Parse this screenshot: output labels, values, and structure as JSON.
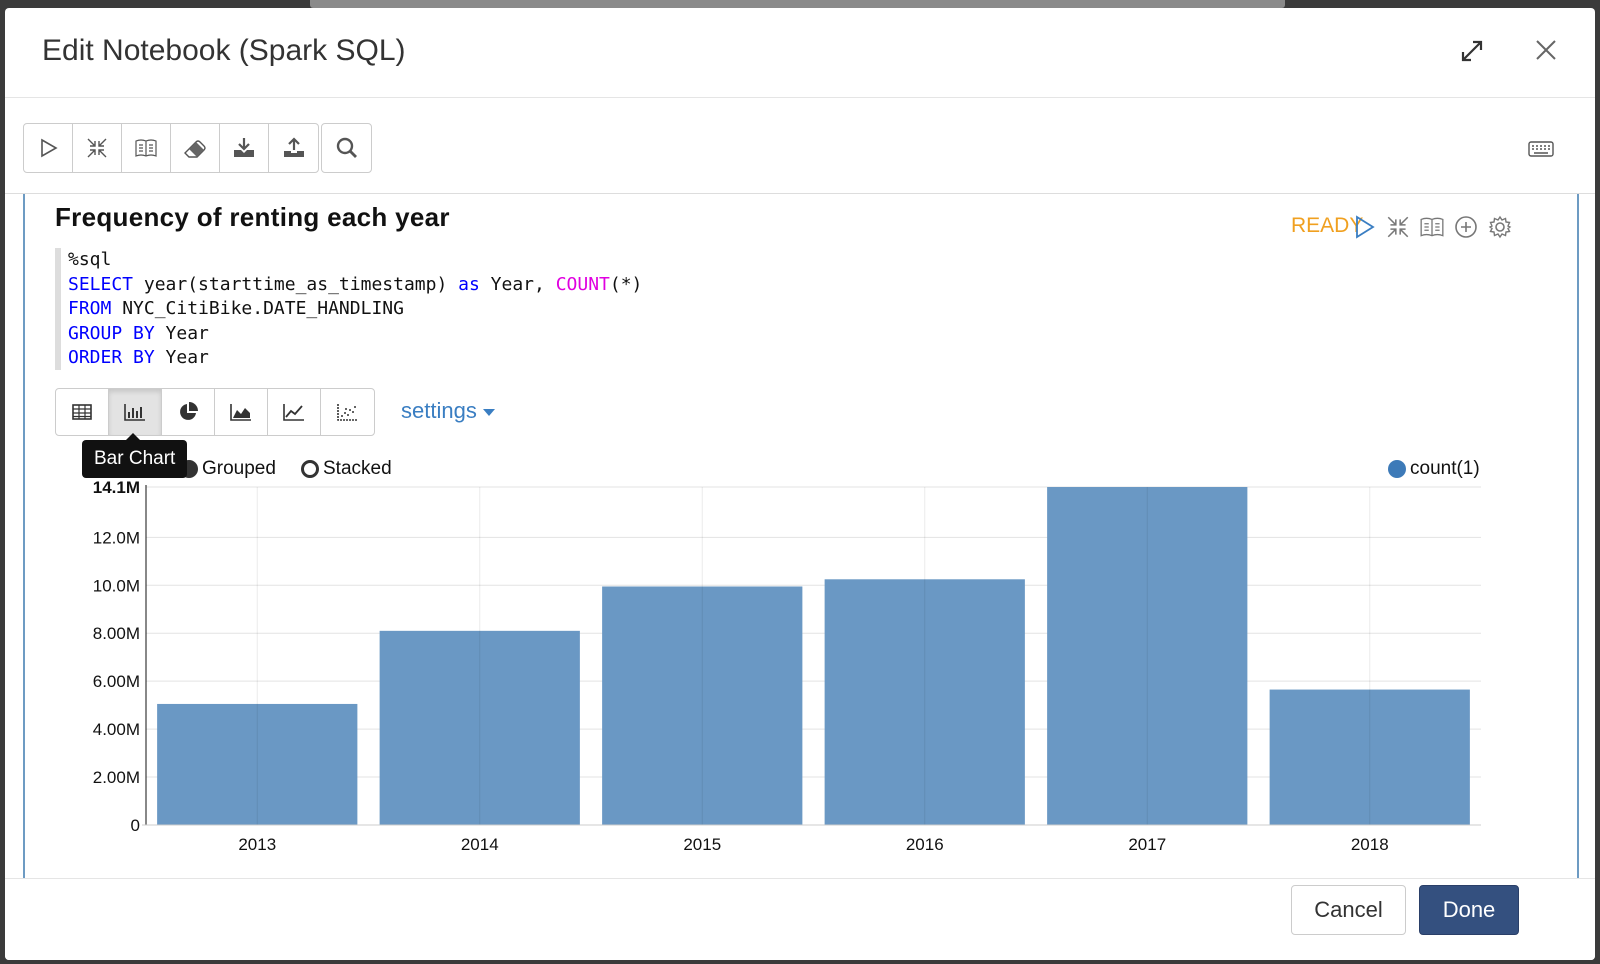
{
  "modal": {
    "title": "Edit Notebook (Spark SQL)"
  },
  "toolbar": {
    "buttons": [
      {
        "icon": "play-icon"
      },
      {
        "icon": "collapse-icon"
      },
      {
        "icon": "book-icon"
      },
      {
        "icon": "eraser-icon"
      },
      {
        "icon": "download-icon"
      },
      {
        "icon": "upload-icon"
      },
      {
        "icon": "search-icon"
      }
    ],
    "keyboard_icon": "keyboard-icon"
  },
  "paragraph": {
    "title": "Frequency of renting each year",
    "status": "READY",
    "code": {
      "line1": "%sql",
      "line2_kw1": "SELECT",
      "line2_a": " year(starttime_as_timestamp) ",
      "line2_kw2": "as",
      "line2_b": " Year, ",
      "line2_fn": "COUNT",
      "line2_c": "(*)",
      "line3_kw": "FROM",
      "line3_a": " NYC_CitiBike.DATE_HANDLING",
      "line4_kw": "GROUP BY",
      "line4_a": " Year",
      "line5_kw": "ORDER BY",
      "line5_a": " Year"
    },
    "settings_label": "settings",
    "tooltip": "Bar Chart",
    "radio_grouped": "Grouped",
    "radio_stacked": "Stacked",
    "legend_label": "count(1)"
  },
  "footer": {
    "cancel_label": "Cancel",
    "done_label": "Done"
  },
  "colors": {
    "bar": "#6a98c4",
    "status": "#f0a020",
    "primary": "#34507f",
    "link": "#3a7ec2"
  },
  "chart_data": {
    "type": "bar",
    "categories": [
      "2013",
      "2014",
      "2015",
      "2016",
      "2017",
      "2018"
    ],
    "series": [
      {
        "name": "count(1)",
        "values": [
          5050000,
          8100000,
          9950000,
          10250000,
          14100000,
          5650000
        ]
      }
    ],
    "ylim": [
      0,
      14100000
    ],
    "yticks": [
      0,
      2000000,
      4000000,
      6000000,
      8000000,
      10000000,
      12000000,
      14100000
    ],
    "ytick_labels": [
      "0",
      "2.00M",
      "4.00M",
      "6.00M",
      "8.00M",
      "10.0M",
      "12.0M",
      "14.1M"
    ],
    "grid": true,
    "legend": "top-right"
  }
}
